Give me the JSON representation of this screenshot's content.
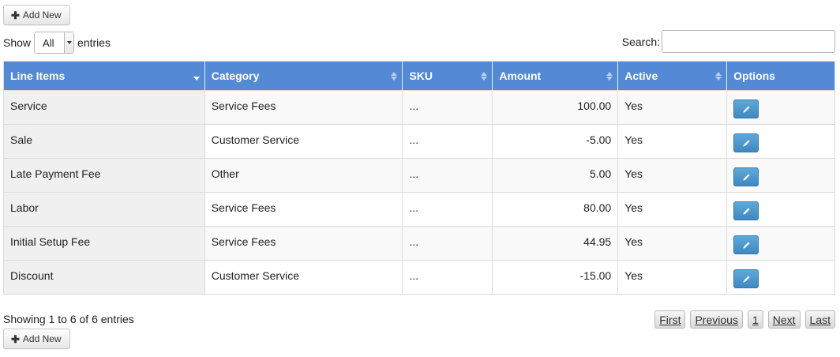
{
  "toolbar": {
    "add_new_label": "Add New"
  },
  "length": {
    "show_label": "Show",
    "selected": "All",
    "entries_label": "entries"
  },
  "search": {
    "label": "Search:",
    "value": ""
  },
  "table": {
    "columns": [
      "Line Items",
      "Category",
      "SKU",
      "Amount",
      "Active",
      "Options"
    ],
    "rows": [
      {
        "name": "Service",
        "category": "Service Fees",
        "sku": "...",
        "amount": "100.00",
        "active": "Yes"
      },
      {
        "name": "Sale",
        "category": "Customer Service",
        "sku": "...",
        "amount": "-5.00",
        "active": "Yes"
      },
      {
        "name": "Late Payment Fee",
        "category": "Other",
        "sku": "...",
        "amount": "5.00",
        "active": "Yes"
      },
      {
        "name": "Labor",
        "category": "Service Fees",
        "sku": "...",
        "amount": "80.00",
        "active": "Yes"
      },
      {
        "name": "Initial Setup Fee",
        "category": "Service Fees",
        "sku": "...",
        "amount": "44.95",
        "active": "Yes"
      },
      {
        "name": "Discount",
        "category": "Customer Service",
        "sku": "...",
        "amount": "-15.00",
        "active": "Yes"
      }
    ]
  },
  "footer": {
    "info": "Showing 1 to 6 of 6 entries"
  },
  "pagination": {
    "first": "First",
    "previous": "Previous",
    "page": "1",
    "next": "Next",
    "last": "Last"
  },
  "colors": {
    "header": "#5489d6",
    "edit_button": "#4a94cc"
  },
  "icons": {
    "add": "plus-icon",
    "edit": "pencil-icon",
    "sort": "sort-icon"
  }
}
